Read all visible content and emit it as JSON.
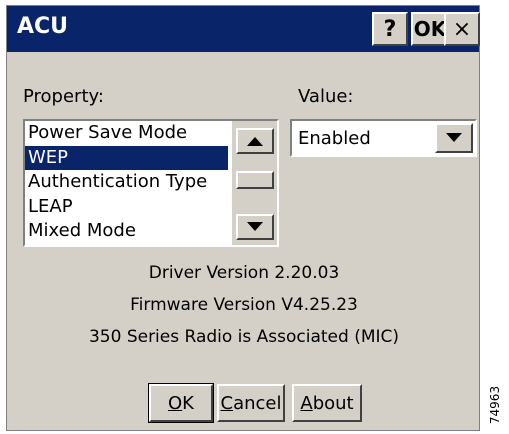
{
  "window": {
    "title": "ACU",
    "help_button": "?",
    "ok_button": "OK",
    "close_button": "×"
  },
  "property": {
    "label": "Property:",
    "items": [
      "Power Save Mode",
      "WEP",
      "Authentication Type",
      "LEAP",
      "Mixed Mode"
    ],
    "selected_index": 1
  },
  "value": {
    "label": "Value:",
    "selected": "Enabled"
  },
  "info": {
    "driver": "Driver Version 2.20.03",
    "firmware": "Firmware Version V4.25.23",
    "status": "350 Series Radio is Associated (MIC)"
  },
  "buttons": {
    "ok": {
      "mnemonic": "O",
      "rest": "K"
    },
    "cancel": {
      "mnemonic": "C",
      "rest": "ancel"
    },
    "about": {
      "mnemonic": "A",
      "rest": "bout"
    }
  },
  "figure_id": "74963",
  "colors": {
    "titlebar": "#0a246a",
    "face": "#d4d0c8",
    "selection": "#0a246a"
  },
  "icons": {
    "scroll_up": "triangle-up",
    "scroll_down": "triangle-down",
    "combo_dropdown": "triangle-down"
  }
}
